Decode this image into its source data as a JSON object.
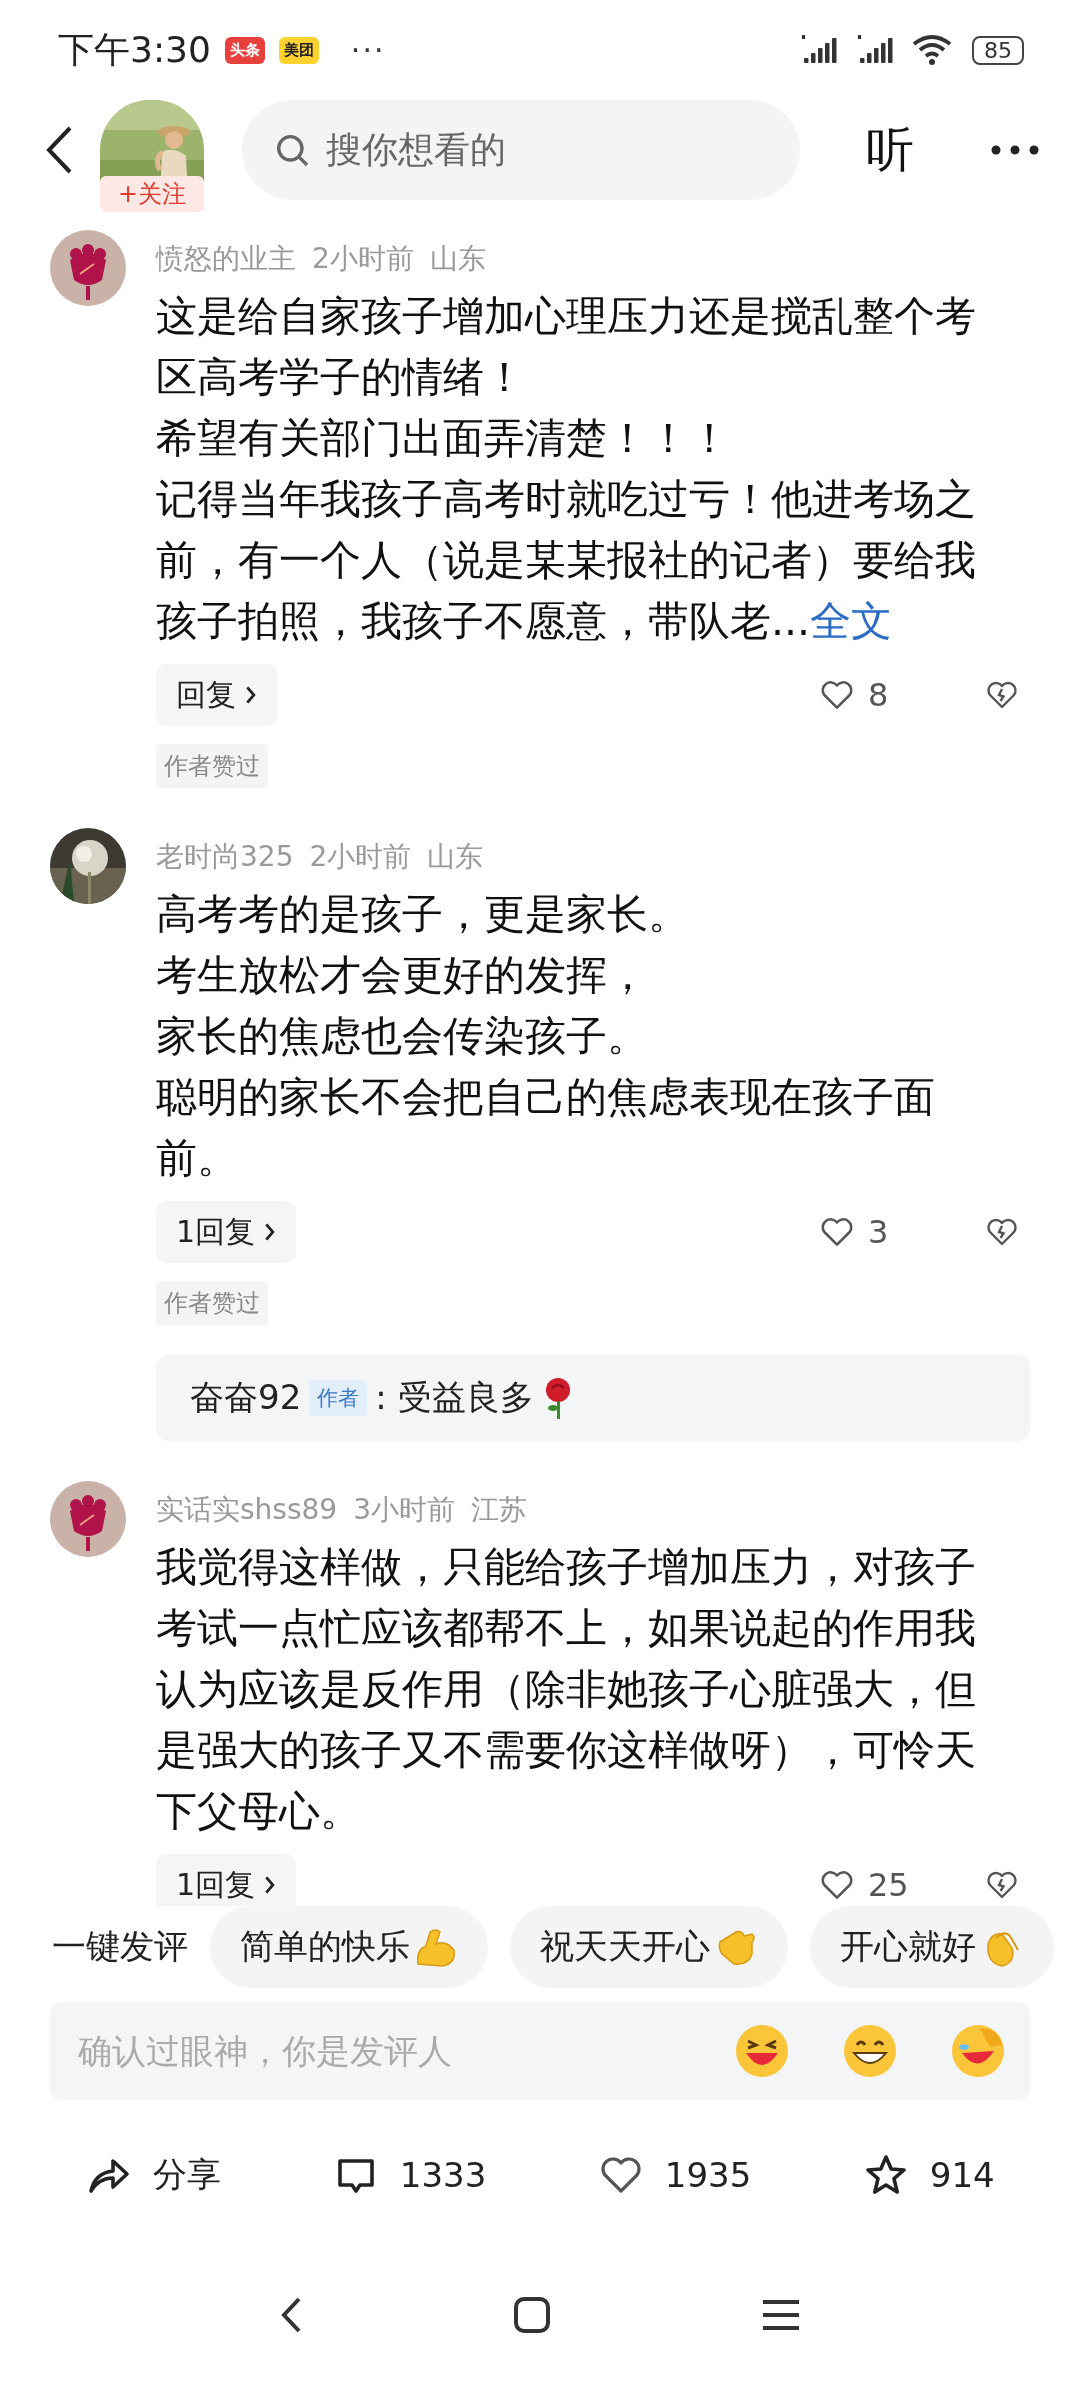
{
  "status_bar": {
    "time": "下午3:30",
    "badges": [
      {
        "label": "头条",
        "color": "#e8403c"
      },
      {
        "label": "美团",
        "color": "#fed22f"
      }
    ],
    "more": "···",
    "battery": "85"
  },
  "header": {
    "follow": "+关注",
    "search_placeholder": "搜你想看的",
    "listen": "听"
  },
  "comments": [
    {
      "author": "愤怒的业主",
      "time": "2小时前",
      "location": "山东",
      "avatar": {
        "kind": "flower"
      },
      "lines": [
        "这是给自家孩子增加心理压力还是搅乱整个考区高考学子的情绪！",
        "希望有关部门出面弄清楚！！！",
        "记得当年我孩子高考时就吃过亏！他进考场之前，有一个人（说是某某报社的记者）要给我孩子拍照，我孩子不愿意，带队老..."
      ],
      "more_link": "全文",
      "reply_label": "回复",
      "likes": "8",
      "author_liked": "作者赞过"
    },
    {
      "author": "老时尚325",
      "time": "2小时前",
      "location": "山东",
      "avatar": {
        "kind": "picture"
      },
      "lines": [
        "高考考的是孩子，更是家长。",
        "考生放松才会更好的发挥，",
        "家长的焦虑也会传染孩子。",
        "聪明的家长不会把自己的焦虑表现在孩子面前。"
      ],
      "reply_label": "1回复",
      "likes": "3",
      "author_liked": "作者赞过",
      "replies": [
        {
          "author": "奋奋92",
          "badge": "作者",
          "text": ": 受益良多"
        }
      ]
    },
    {
      "author": "实话实shss89",
      "time": "3小时前",
      "location": "江苏",
      "avatar": {
        "kind": "flower"
      },
      "lines": [
        "我觉得这样做，只能给孩子增加压力，对孩子考试一点忙应该都帮不上，如果说起的作用我认为应该是反作用（除非她孩子心脏强大，但是强大的孩子又不需要你这样做呀），可怜天下父母心。"
      ],
      "reply_label": "1回复",
      "likes": "25"
    }
  ],
  "quick_comments": {
    "label": "一键发评",
    "chips": [
      "简单的快乐",
      "祝天天开心",
      "开心就好"
    ]
  },
  "comment_box": {
    "placeholder": "确认过眼神，你是发评人"
  },
  "actions": [
    {
      "kind": "share",
      "label": "分享"
    },
    {
      "kind": "comment",
      "label": "1333"
    },
    {
      "kind": "like",
      "label": "1935"
    },
    {
      "kind": "favorite",
      "label": "914"
    }
  ]
}
